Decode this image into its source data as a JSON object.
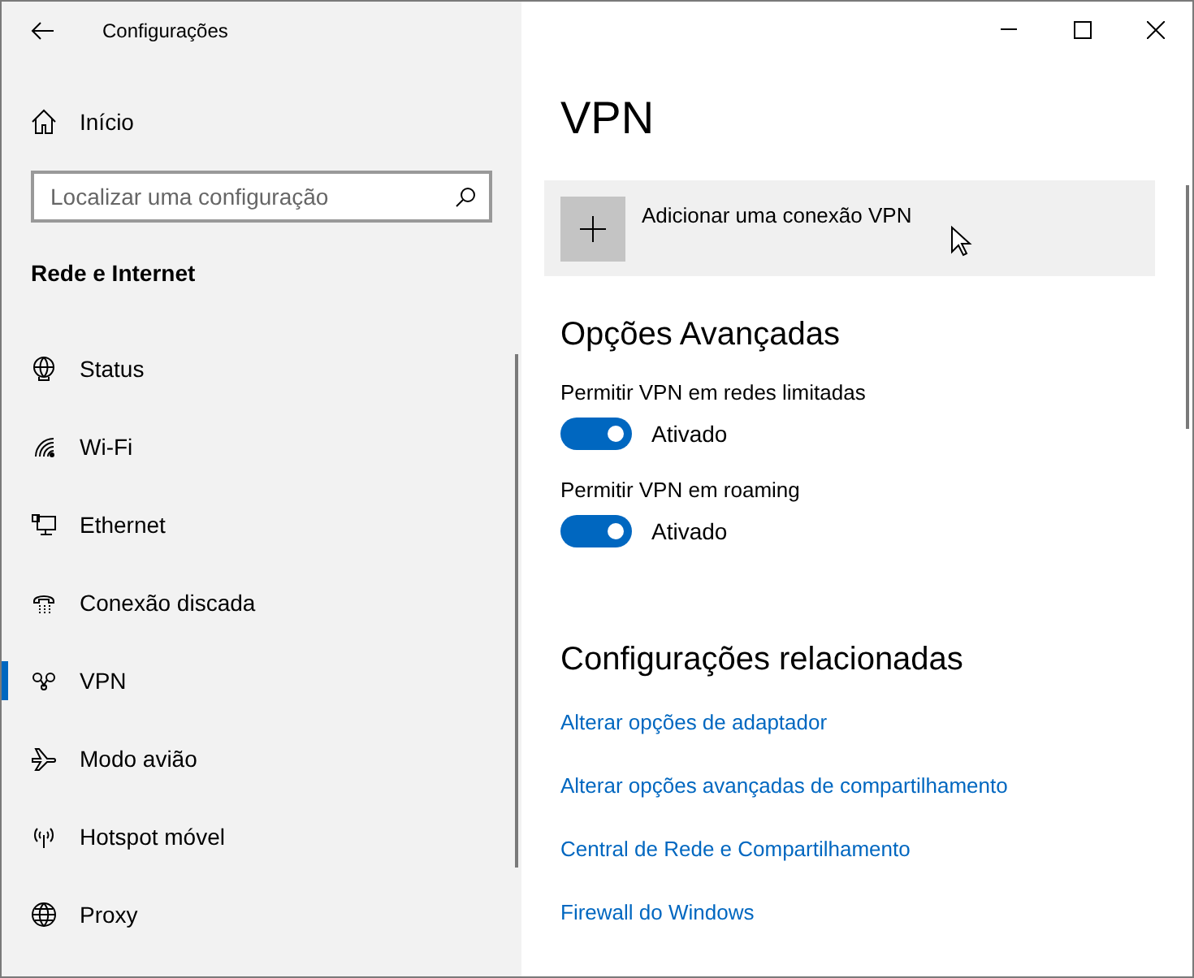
{
  "window": {
    "title": "Configurações"
  },
  "sidebar": {
    "home": "Início",
    "search": {
      "placeholder": "Localizar uma configuração"
    },
    "section": "Rede e Internet",
    "items": [
      {
        "label": "Status",
        "kind": "status",
        "selected": false
      },
      {
        "label": "Wi-Fi",
        "kind": "wifi",
        "selected": false
      },
      {
        "label": "Ethernet",
        "kind": "ethernet",
        "selected": false
      },
      {
        "label": "Conexão discada",
        "kind": "dialup",
        "selected": false
      },
      {
        "label": "VPN",
        "kind": "vpn",
        "selected": true
      },
      {
        "label": "Modo avião",
        "kind": "airplane",
        "selected": false
      },
      {
        "label": "Hotspot móvel",
        "kind": "hotspot",
        "selected": false
      },
      {
        "label": "Proxy",
        "kind": "proxy",
        "selected": false
      }
    ]
  },
  "page": {
    "title": "VPN",
    "add_button": "Adicionar uma conexão VPN",
    "advanced": {
      "heading": "Opções Avançadas",
      "toggles": [
        {
          "label": "Permitir VPN em redes limitadas",
          "on": true,
          "state": "Ativado"
        },
        {
          "label": "Permitir VPN em roaming",
          "on": true,
          "state": "Ativado"
        }
      ]
    },
    "related": {
      "heading": "Configurações relacionadas",
      "links": [
        "Alterar opções de adaptador",
        "Alterar opções avançadas de compartilhamento",
        "Central de Rede e Compartilhamento",
        "Firewall do Windows"
      ]
    }
  }
}
